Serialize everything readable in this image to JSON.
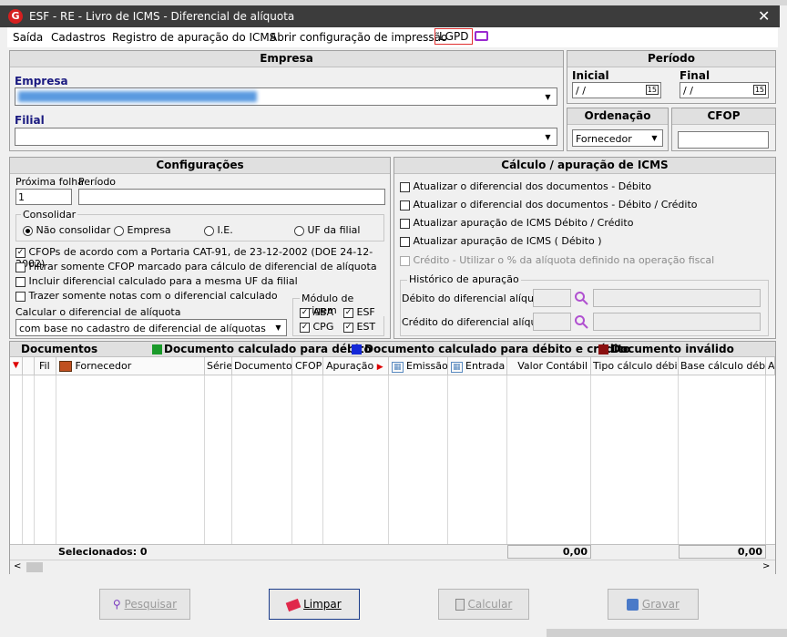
{
  "window": {
    "title": "ESF - RE - Livro de ICMS - Diferencial de alíquota",
    "close": "✕"
  },
  "menu": [
    "Saída",
    "Cadastros",
    "Registro de apuração do ICMS",
    "Abrir configuração de impressão",
    "LGPD"
  ],
  "empresa": {
    "header": "Empresa",
    "empresa_label": "Empresa",
    "filial_label": "Filial"
  },
  "periodo": {
    "header": "Período",
    "inicial_label": "Inicial",
    "final_label": "Final",
    "inicial_value": " / /",
    "final_value": " / /",
    "cal_label": "15"
  },
  "ordenacao": {
    "header": "Ordenação",
    "value": "Fornecedor"
  },
  "cfop": {
    "header": "CFOP"
  },
  "config": {
    "header": "Configurações",
    "proxima_label": "Próxima folha",
    "proxima_value": "1",
    "periodo_label": "Período",
    "consolidar_label": "Consolidar",
    "radios": [
      "Não consolidar",
      "Empresa",
      "I.E.",
      "UF da filial"
    ],
    "checks": [
      {
        "label": "CFOPs de acordo com a Portaria CAT-91, de 23-12-2002 (DOE 24-12-2002)",
        "checked": true
      },
      {
        "label": "Filtrar somente CFOP marcado para cálculo de diferencial de alíquota",
        "checked": false
      },
      {
        "label": "Incluir diferencial calculado para a mesma UF da filial",
        "checked": false
      },
      {
        "label": "Trazer somente notas com o diferencial calculado",
        "checked": false
      }
    ],
    "calc_label": "Calcular o diferencial de alíquota",
    "calc_value": "com base no cadastro de diferencial de alíquotas",
    "modulo_label": "Módulo de origem",
    "modulos": [
      "ABA",
      "ESF",
      "CPG",
      "EST"
    ]
  },
  "calculo": {
    "header": "Cálculo / apuração de ICMS",
    "checks": [
      "Atualizar o diferencial dos documentos - Débito",
      "Atualizar o diferencial dos documentos - Débito / Crédito",
      "Atualizar apuração de ICMS Débito / Crédito",
      "Atualizar apuração de ICMS ( Débito )",
      "Crédito - Utilizar o % da alíquota definido na operação fiscal"
    ],
    "historico_label": "Histórico de apuração",
    "debito_label": "Débito do diferencial alíquota",
    "credito_label": "Crédito do diferencial alíquota"
  },
  "documentos": {
    "title": "Documentos",
    "legend": [
      {
        "label": "Documento calculado para débito",
        "color": "#1a9a2a"
      },
      {
        "label": "Documento calculado para débito e crédito",
        "color": "#1428d8"
      },
      {
        "label": "Documento inválido",
        "color": "#8a1010"
      }
    ],
    "columns": [
      "Fil",
      "Fornecedor",
      "Série",
      "Documento",
      "CFOP",
      "Apuração",
      "Emissão",
      "Entrada",
      "Valor Contábil",
      "Tipo cálculo débito",
      "Base cálculo débito",
      "A"
    ],
    "selecionados": "Selecionados: 0",
    "total1": "0,00",
    "total2": "0,00"
  },
  "buttons": {
    "pesquisar": "Pesquisar",
    "limpar": "Limpar",
    "calcular": "Calcular",
    "gravar": "Gravar"
  },
  "colors": {
    "titlebar": "#3c3c3c",
    "accent": "#1a1a80",
    "lgpd_border": "#e03030"
  }
}
